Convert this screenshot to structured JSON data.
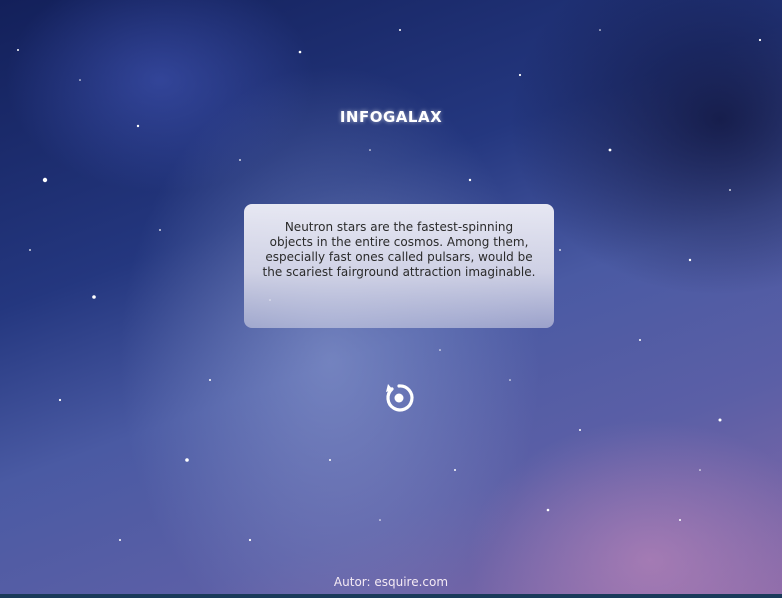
{
  "header": {
    "title": "INFOGALAX"
  },
  "fact_card": {
    "text": "Neutron stars are the fastest-spinning objects in the entire cosmos. Among them, especially fast ones called pulsars, would be the scariest fairground attraction imaginable."
  },
  "controls": {
    "reload_icon": "refresh-icon"
  },
  "footer": {
    "author": "Autor: esquire.com"
  },
  "colors": {
    "title": "#ffffff",
    "card_text": "#2a2a2a",
    "footer_text": "#f4eaf4"
  }
}
